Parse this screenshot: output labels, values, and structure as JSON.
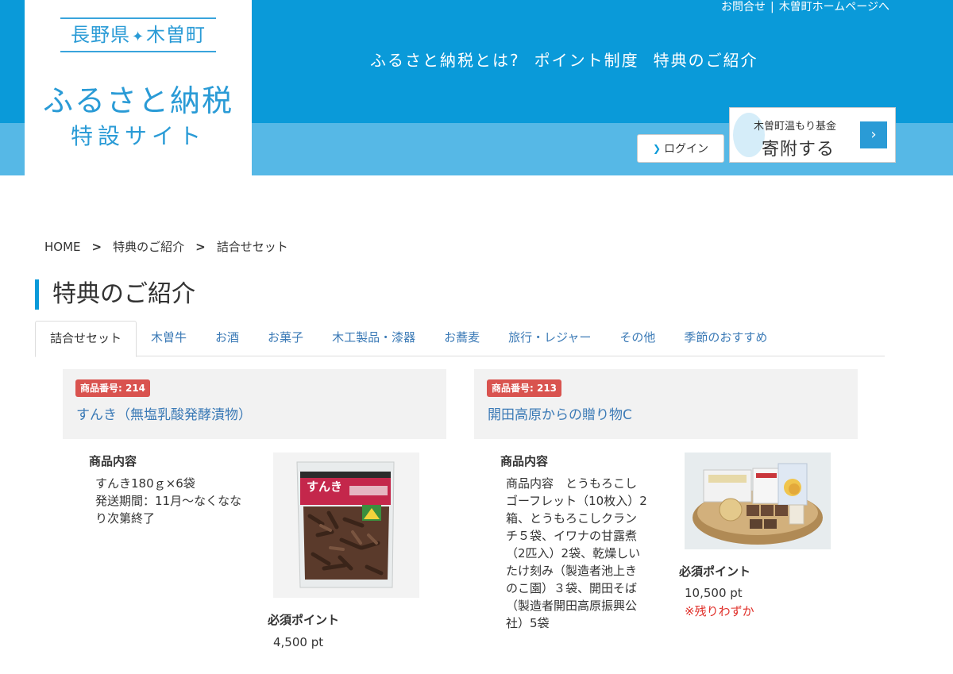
{
  "header": {
    "logo_pref": "長野県",
    "logo_town": "木曽町",
    "logo_main": "ふるさと納税",
    "logo_sub": "特設サイト",
    "links": [
      "お問合せ",
      "木曽町ホームページへ"
    ],
    "link_separator": "|",
    "nav": [
      "ふるさと納税とは?",
      "ポイント制度",
      "特典のご紹介"
    ],
    "login_label": "ログイン",
    "fund_label": "木曽町温もり基金",
    "donate_label": "寄附する"
  },
  "breadcrumb": [
    "HOME",
    "特典のご紹介",
    "詰合せセット"
  ],
  "breadcrumb_separator": ">",
  "page_title": "特典のご紹介",
  "tabs": [
    "詰合せセット",
    "木曽牛",
    "お酒",
    "お菓子",
    "木工製品・漆器",
    "お蕎麦",
    "旅行・レジャー",
    "その他",
    "季節のおすすめ"
  ],
  "active_tab": "詰合せセット",
  "products": [
    {
      "badge": "商品番号: 214",
      "title": "すんき（無塩乳酸発酵漬物）",
      "contents_heading": "商品内容",
      "contents_lines": [
        "すんき180ｇ×6袋",
        "発送期間：11月～なくなな",
        "り次第終了"
      ],
      "required_heading": "必須ポイント",
      "points": "4,500 pt",
      "image_label": "すんき"
    },
    {
      "badge": "商品番号: 213",
      "title": "開田高原からの贈り物C",
      "contents_heading": "商品内容",
      "contents_lines": [
        "商品内容　とうもろこし",
        "ゴーフレット（10枚入）2",
        "箱、とうもろこしクラン",
        "チ５袋、イワナの甘露煮",
        "（2匹入）2袋、乾燥しい",
        "たけ刻み（製造者池上き",
        "のこ園）３袋、開田そば",
        "（製造者開田高原振興公",
        "社）5袋"
      ],
      "required_heading": "必須ポイント",
      "points": "10,500 pt",
      "stock_note": "※残りわずか"
    }
  ],
  "colors": {
    "header_blue": "#0a9ad9",
    "header_light_blue": "#56b8e6",
    "link_blue": "#3b7ab6",
    "badge_red": "#d9534f",
    "alert_red": "#e0302a"
  }
}
